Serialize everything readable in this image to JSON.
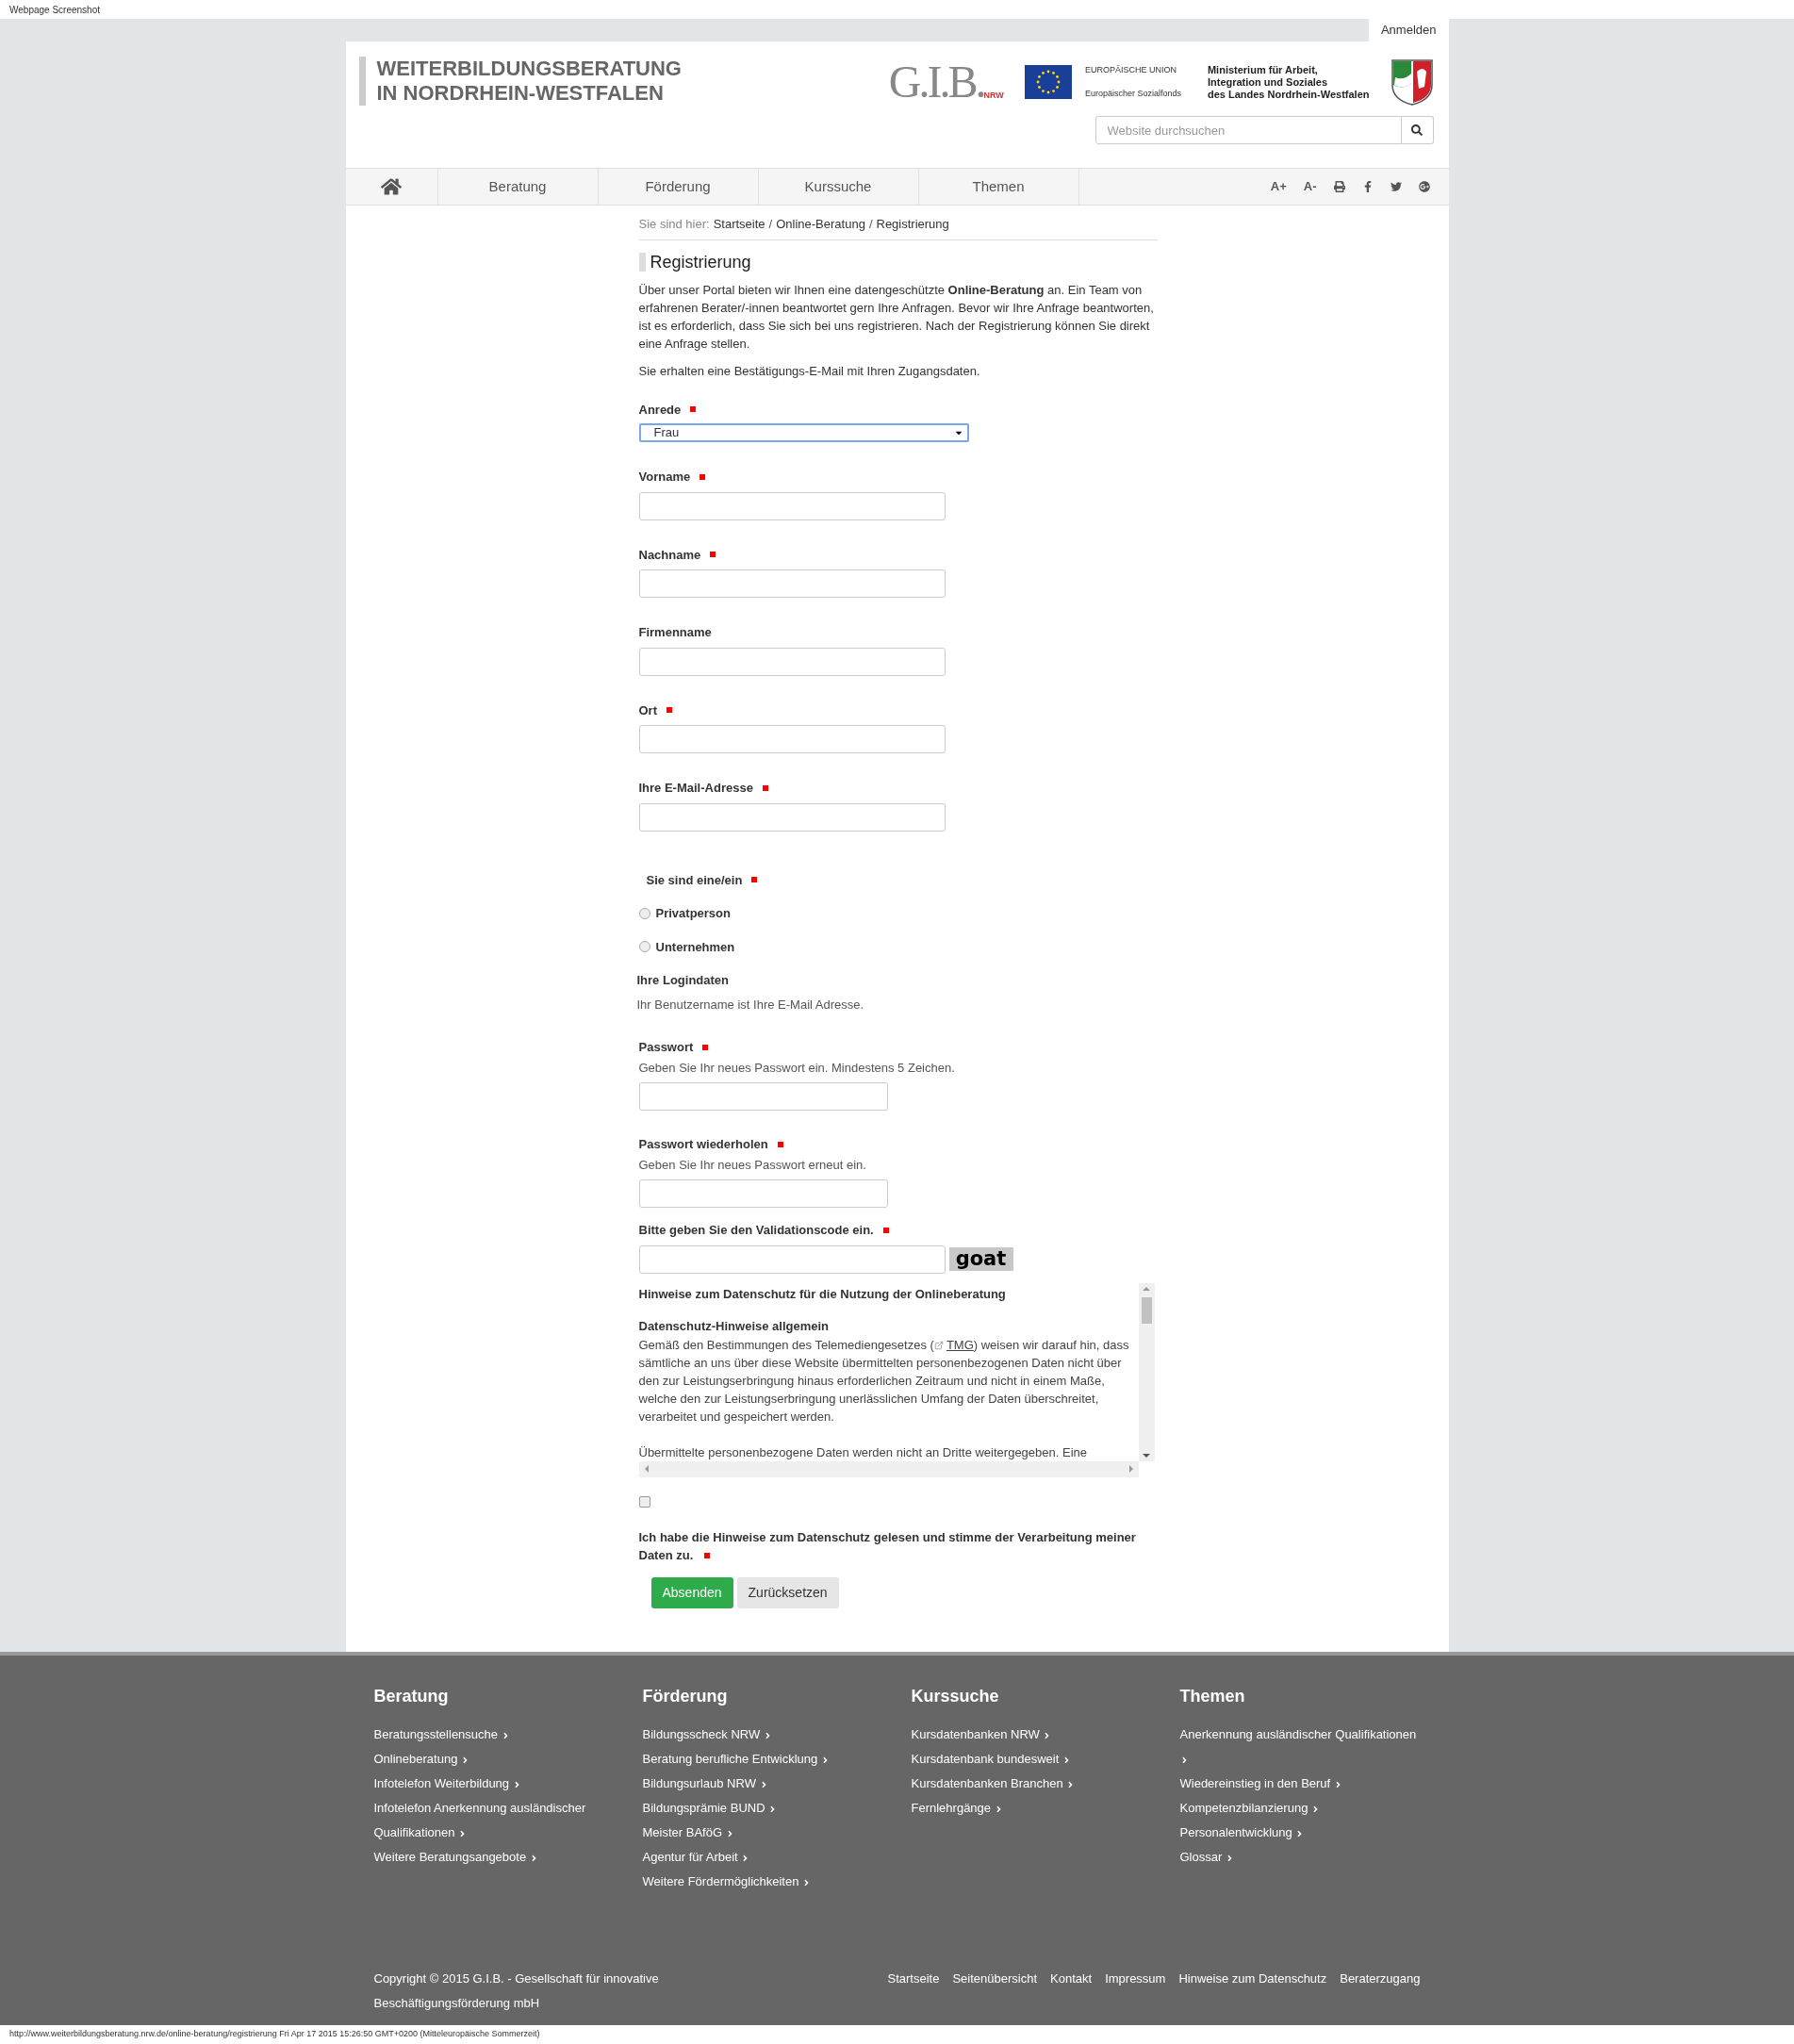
{
  "browser": {
    "caption": "Webpage Screenshot",
    "status": "http://www.weiterbildungsberatung.nrw.de/online-beratung/registrierung Fri Apr 17 2015 15:26:50 GMT+0200 (Mitteleuropäische Sommerzeit)"
  },
  "login_link": "Anmelden",
  "header": {
    "title_lines": [
      "WEITERBILDUNGSBERATUNG",
      "IN NORDRHEIN-WESTFALEN"
    ],
    "gib_logo": "G.I.B.",
    "gib_suffix": "NRW",
    "eu_title": "EUROPÄISCHE UNION",
    "eu_subtitle": "Europäischer Sozialfonds",
    "ministry_lines": [
      "Ministerium für Arbeit,",
      "Integration und Soziales",
      "des Landes Nordrhein-Westfalen"
    ]
  },
  "search": {
    "placeholder": "Website durchsuchen"
  },
  "nav": [
    {
      "label": "Beratung",
      "selected": false
    },
    {
      "label": "Förderung",
      "selected": false
    },
    {
      "label": "Kurssuche",
      "selected": false
    },
    {
      "label": "Themen",
      "selected": false
    }
  ],
  "tools": [
    {
      "kind": "text",
      "label": "A+"
    },
    {
      "kind": "text",
      "label": "A-"
    },
    {
      "kind": "print"
    },
    {
      "kind": "facebook"
    },
    {
      "kind": "twitter"
    },
    {
      "kind": "googleplus"
    }
  ],
  "breadcrumb": {
    "prefix": "Sie sind hier:",
    "separator": "/",
    "items": [
      "Startseite",
      "Online-Beratung",
      "Registrierung"
    ]
  },
  "heading": "Registrierung",
  "intro": [
    "Über unser Portal bieten wir Ihnen eine datengeschützte **Online-Beratung** an. Ein Team von erfahrenen Berater/-innen beantwortet gern Ihre Anfragen. Bevor wir Ihre Anfrage beantworten, ist es erforderlich, dass Sie sich bei uns registrieren. Nach der Registrierung können Sie direkt eine Anfrage stellen.",
    "Sie erhalten eine Bestätigungs-E-Mail mit Ihren Zugangsdaten."
  ],
  "fields": [
    {
      "kind": "select",
      "label": "Anrede",
      "required": true,
      "value": "Frau"
    },
    {
      "kind": "text",
      "label": "Vorname",
      "required": true
    },
    {
      "kind": "text",
      "label": "Nachname",
      "required": true
    },
    {
      "kind": "text",
      "label": "Firmenname",
      "required": false
    },
    {
      "kind": "text",
      "label": "Ort",
      "required": true
    },
    {
      "kind": "text",
      "label": "Ihre E-Mail-Adresse",
      "required": true
    },
    {
      "kind": "radio",
      "label": "Sie sind eine/ein",
      "required": true,
      "options": [
        {
          "label": "Privatperson",
          "selected": false
        },
        {
          "label": "Unternehmen",
          "selected": false
        }
      ]
    },
    {
      "kind": "section",
      "label": "Ihre Logindaten",
      "note": "Ihr Benutzername ist Ihre E-Mail Adresse."
    },
    {
      "kind": "password",
      "label": "Passwort",
      "required": true,
      "hint": "Geben Sie Ihr neues Passwort ein. Mindestens 5 Zeichen."
    },
    {
      "kind": "password",
      "label": "Passwort wiederholen",
      "required": true,
      "hint": "Geben Sie Ihr neues Passwort erneut ein."
    },
    {
      "kind": "captcha",
      "label": "Bitte geben Sie den Validationscode ein.",
      "required": true,
      "code": "goat"
    }
  ],
  "privacy": {
    "title": "Hinweise zum Datenschutz für die Nutzung der Onlineberatung",
    "subtitle": "Datenschutz-Hinweise allgemein",
    "para1_before": "Gemäß den Bestimmungen des Telemediengesetzes (",
    "para1_link": "TMG",
    "para1_after": ") weisen wir darauf hin, dass sämtliche an uns über diese Website übermittelten personenbezogenen Daten nicht über den zur Leistungserbringung hinaus erforderlichen Zeitraum und nicht in einem Maße, welche den zur Leistungserbringung unerlässlichen Umfang der Daten überschreitet, verarbeitet und gespeichert werden.",
    "para2": "Übermittelte personenbezogene Daten werden nicht an Dritte weitergegeben. Eine"
  },
  "consent": {
    "checked": false,
    "label": "Ich habe die Hinweise zum Datenschutz gelesen und stimme der Verarbeitung meiner Daten zu.",
    "required": true
  },
  "buttons": [
    {
      "label": "Absenden",
      "kind": "primary"
    },
    {
      "label": "Zurücksetzen",
      "kind": "secondary"
    }
  ],
  "footer": {
    "columns": [
      {
        "title": "Beratung",
        "links": [
          "Beratungsstellensuche",
          "Onlineberatung",
          "Infotelefon Weiterbildung",
          "Infotelefon Anerkennung ausländischer Qualifikationen",
          "Weitere Beratungsangebote"
        ]
      },
      {
        "title": "Förderung",
        "links": [
          "Bildungsscheck NRW",
          "Beratung berufliche Entwicklung",
          "Bildungsurlaub NRW",
          "Bildungsprämie BUND",
          "Meister BAföG",
          "Agentur für Arbeit",
          "Weitere Fördermöglichkeiten"
        ]
      },
      {
        "title": "Kurssuche",
        "links": [
          "Kursdatenbanken NRW",
          "Kursdatenbank bundesweit",
          "Kursdatenbanken Branchen",
          "Fernlehrgänge"
        ]
      },
      {
        "title": "Themen",
        "links": [
          "Anerkennung ausländischer Qualifikationen",
          "Wiedereinstieg in den Beruf",
          "Kompetenzbilanzierung",
          "Personalentwicklung",
          "Glossar"
        ]
      }
    ],
    "copyright": "Copyright © 2015 G.I.B. - Gesellschaft für innovative Beschäftigungsförderung mbH",
    "links": [
      "Startseite",
      "Seitenübersicht",
      "Kontakt",
      "Impressum",
      "Hinweise zum Datenschutz",
      "Beraterzugang"
    ]
  }
}
